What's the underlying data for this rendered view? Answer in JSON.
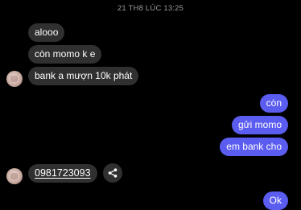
{
  "chat": {
    "timestamp": "21 TH8 LÚC 13:25",
    "incoming": {
      "msg1": "alooo",
      "msg2": "còn momo k e",
      "msg3": "bank a mượn 10k phát",
      "phone": "0981723093"
    },
    "outgoing": {
      "msg1": "còn",
      "msg2": "gửi momo",
      "msg3": "em bank cho",
      "msg4": "Ok"
    }
  },
  "colors": {
    "background": "#000000",
    "incoming_bubble": "#303030",
    "outgoing_bubble": "#5b5cf0",
    "timestamp_text": "#9a9a9a"
  },
  "icons": {
    "share": "share-icon",
    "avatar": "contact-avatar"
  }
}
